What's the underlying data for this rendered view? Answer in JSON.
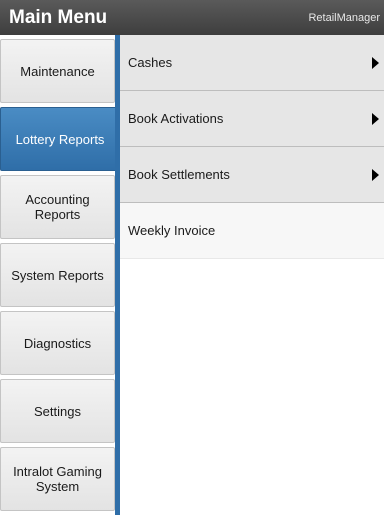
{
  "titlebar": {
    "title": "Main Menu",
    "app_name": "RetailManager"
  },
  "sidebar": {
    "items": [
      {
        "label": "Maintenance",
        "active": false
      },
      {
        "label": "Lottery Reports",
        "active": true
      },
      {
        "label": "Accounting\nReports",
        "active": false
      },
      {
        "label": "System Reports",
        "active": false
      },
      {
        "label": "Diagnostics",
        "active": false
      },
      {
        "label": "Settings",
        "active": false
      },
      {
        "label": "Intralot Gaming\nSystem",
        "active": false
      }
    ]
  },
  "submenu": {
    "items": [
      {
        "label": "Cashes",
        "has_submenu": true,
        "icon": "chevron-right-icon"
      },
      {
        "label": "Book Activations",
        "has_submenu": true,
        "icon": "chevron-right-icon"
      },
      {
        "label": "Book Settlements",
        "has_submenu": true,
        "icon": "chevron-right-icon"
      },
      {
        "label": "Weekly Invoice",
        "has_submenu": false
      }
    ]
  },
  "colors": {
    "titlebar": "#4a4a4a",
    "accent": "#2f6ea8",
    "nav_bg": "#e8e8e8"
  }
}
